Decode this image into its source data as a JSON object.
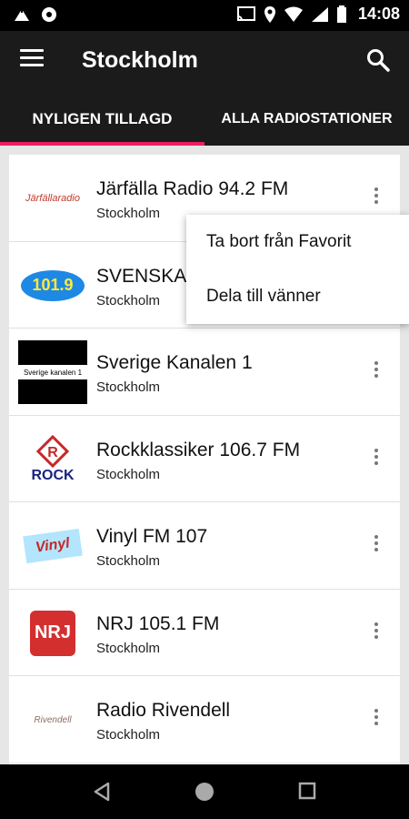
{
  "status_bar": {
    "time": "14:08"
  },
  "app_bar": {
    "title": "Stockholm"
  },
  "tabs": [
    {
      "label": "NYLIGEN TILLAGD",
      "active": true
    },
    {
      "label": "ALLA RADIOSTATIONER",
      "active": false
    }
  ],
  "stations": [
    {
      "name": "Järfälla Radio 94.2 FM",
      "city": "Stockholm",
      "logo_text": "Järfällaradio"
    },
    {
      "name": "SVENSKA",
      "city": "Stockholm",
      "logo_text": "101.9"
    },
    {
      "name": "Sverige Kanalen 1",
      "city": "Stockholm",
      "logo_text": "Sverige kanalen 1"
    },
    {
      "name": "Rockklassiker 106.7 FM",
      "city": "Stockholm",
      "logo_text": "ROCK"
    },
    {
      "name": "Vinyl FM 107",
      "city": "Stockholm",
      "logo_text": "Vinyl"
    },
    {
      "name": "NRJ 105.1 FM",
      "city": "Stockholm",
      "logo_text": "NRJ"
    },
    {
      "name": "Radio Rivendell",
      "city": "Stockholm",
      "logo_text": "Rivendell"
    }
  ],
  "context_menu": {
    "items": [
      "Ta bort från Favorit",
      "Dela till vänner"
    ]
  },
  "colors": {
    "accent": "#e91e63",
    "app_bar": "#1b1b1b"
  }
}
